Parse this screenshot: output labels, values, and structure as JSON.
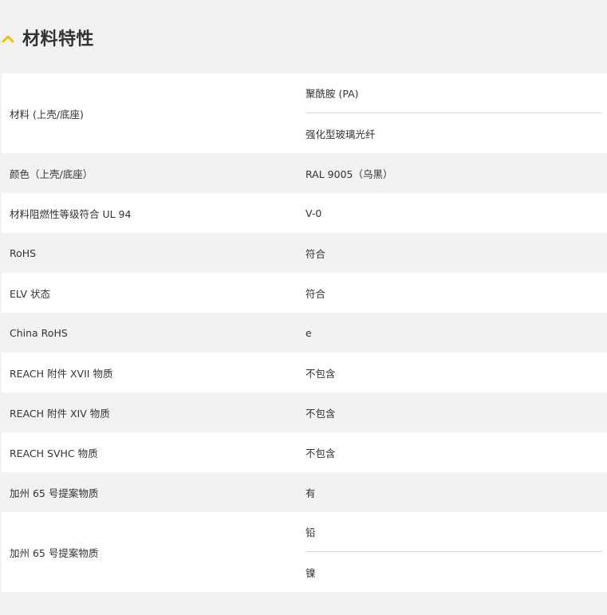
{
  "section": {
    "title": "材料特性",
    "accent": "#f2c200",
    "icon": "chevron-up-icon"
  },
  "rows": [
    {
      "key": "材料 (上壳/底座)",
      "values": [
        "聚酰胺 (PA)",
        "强化型玻璃光纤"
      ]
    },
    {
      "key": "颜色（上壳/底座）",
      "values": [
        "RAL 9005（乌黑）"
      ]
    },
    {
      "key": "材料阻燃性等级符合 UL 94",
      "values": [
        "V-0"
      ]
    },
    {
      "key": "RoHS",
      "values": [
        "符合"
      ]
    },
    {
      "key": "ELV 状态",
      "values": [
        "符合"
      ]
    },
    {
      "key": "China RoHS",
      "values": [
        "e"
      ]
    },
    {
      "key": "REACH 附件 XVII 物质",
      "values": [
        "不包含"
      ]
    },
    {
      "key": "REACH 附件 XIV 物质",
      "values": [
        "不包含"
      ]
    },
    {
      "key": "REACH SVHC 物质",
      "values": [
        "不包含"
      ]
    },
    {
      "key": "加州 65 号提案物质",
      "values": [
        "有"
      ]
    },
    {
      "key": "加州 65 号提案物质",
      "values": [
        "铅",
        "镍"
      ]
    }
  ]
}
